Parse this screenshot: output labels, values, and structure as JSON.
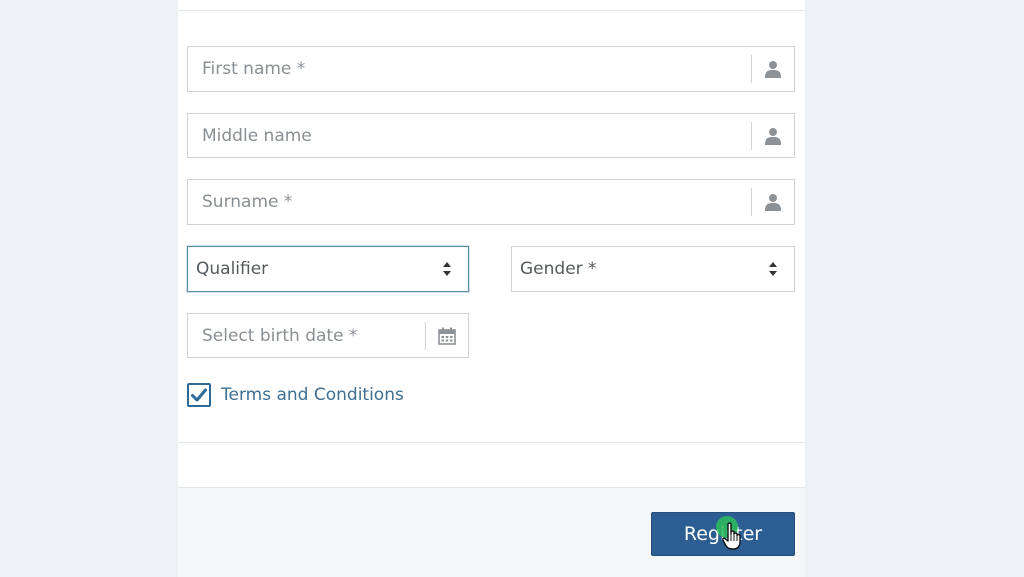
{
  "form": {
    "first_name": {
      "placeholder": "First name *"
    },
    "middle_name": {
      "placeholder": "Middle name"
    },
    "surname": {
      "placeholder": "Surname *"
    },
    "qualifier": {
      "value": "Qualifier"
    },
    "gender": {
      "value": "Gender *"
    },
    "birth_date": {
      "placeholder": "Select birth date *"
    },
    "terms": {
      "label": "Terms and Conditions",
      "checked": true
    }
  },
  "footer": {
    "register_label": "Register"
  },
  "icons": {
    "field_person": "user-icon",
    "date_picker": "calendar-icon",
    "select_arrows": "sort-icon",
    "check": "check-icon",
    "pointer": "hand-pointer-icon"
  },
  "colors": {
    "primary": "#2c5e94",
    "link": "#3f6f92",
    "focus_border": "#5a8da6",
    "click_indicator": "#2ebe5a"
  }
}
